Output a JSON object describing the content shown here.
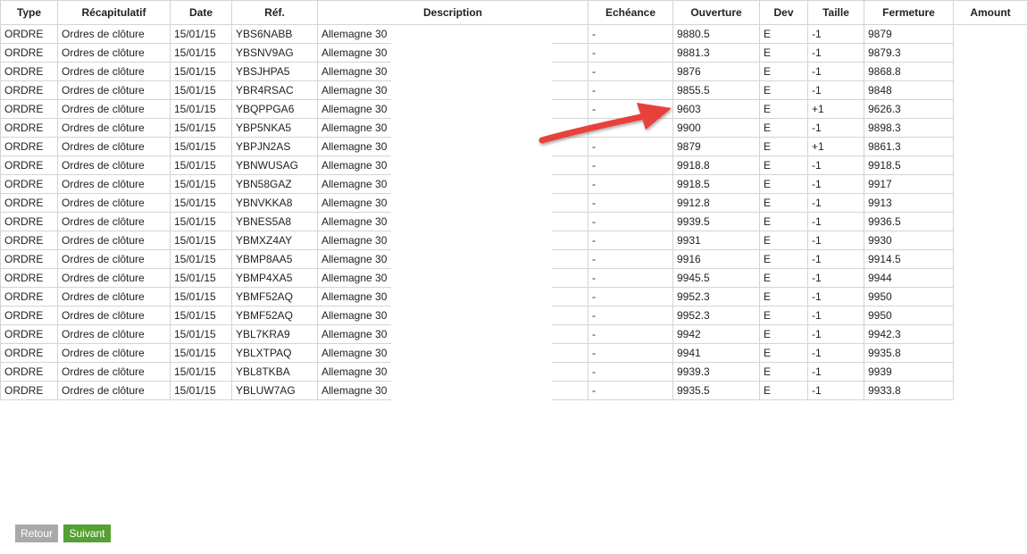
{
  "table": {
    "headers": [
      "Type",
      "Récapitulatif",
      "Date",
      "Réf.",
      "Description",
      "Echéance",
      "Ouverture",
      "Dev",
      "Taille",
      "Fermeture",
      "Amount"
    ],
    "rows": [
      [
        "ORDRE",
        "Ordres de clôture",
        "15/01/15",
        "YBS6NABB",
        "Allemagne 30",
        "-",
        "9880.5",
        "E",
        "-1",
        "9879",
        ""
      ],
      [
        "ORDRE",
        "Ordres de clôture",
        "15/01/15",
        "YBSNV9AG",
        "Allemagne 30",
        "-",
        "9881.3",
        "E",
        "-1",
        "9879.3",
        ""
      ],
      [
        "ORDRE",
        "Ordres de clôture",
        "15/01/15",
        "YBSJHPA5",
        "Allemagne 30",
        "-",
        "9876",
        "E",
        "-1",
        "9868.8",
        ""
      ],
      [
        "ORDRE",
        "Ordres de clôture",
        "15/01/15",
        "YBR4RSAC",
        "Allemagne 30",
        "-",
        "9855.5",
        "E",
        "-1",
        "9848",
        ""
      ],
      [
        "ORDRE",
        "Ordres de clôture",
        "15/01/15",
        "YBQPPGA6",
        "Allemagne 30",
        "-",
        "9603",
        "E",
        "+1",
        "9626.3",
        ""
      ],
      [
        "ORDRE",
        "Ordres de clôture",
        "15/01/15",
        "YBP5NKA5",
        "Allemagne 30",
        "-",
        "9900",
        "E",
        "-1",
        "9898.3",
        ""
      ],
      [
        "ORDRE",
        "Ordres de clôture",
        "15/01/15",
        "YBPJN2AS",
        "Allemagne 30",
        "-",
        "9879",
        "E",
        "+1",
        "9861.3",
        ""
      ],
      [
        "ORDRE",
        "Ordres de clôture",
        "15/01/15",
        "YBNWUSAG",
        "Allemagne 30",
        "-",
        "9918.8",
        "E",
        "-1",
        "9918.5",
        ""
      ],
      [
        "ORDRE",
        "Ordres de clôture",
        "15/01/15",
        "YBN58GAZ",
        "Allemagne 30",
        "-",
        "9918.5",
        "E",
        "-1",
        "9917",
        ""
      ],
      [
        "ORDRE",
        "Ordres de clôture",
        "15/01/15",
        "YBNVKKA8",
        "Allemagne 30",
        "-",
        "9912.8",
        "E",
        "-1",
        "9913",
        ""
      ],
      [
        "ORDRE",
        "Ordres de clôture",
        "15/01/15",
        "YBNES5A8",
        "Allemagne 30",
        "-",
        "9939.5",
        "E",
        "-1",
        "9936.5",
        ""
      ],
      [
        "ORDRE",
        "Ordres de clôture",
        "15/01/15",
        "YBMXZ4AY",
        "Allemagne 30",
        "-",
        "9931",
        "E",
        "-1",
        "9930",
        ""
      ],
      [
        "ORDRE",
        "Ordres de clôture",
        "15/01/15",
        "YBMP8AA5",
        "Allemagne 30",
        "-",
        "9916",
        "E",
        "-1",
        "9914.5",
        ""
      ],
      [
        "ORDRE",
        "Ordres de clôture",
        "15/01/15",
        "YBMP4XA5",
        "Allemagne 30",
        "-",
        "9945.5",
        "E",
        "-1",
        "9944",
        ""
      ],
      [
        "ORDRE",
        "Ordres de clôture",
        "15/01/15",
        "YBMF52AQ",
        "Allemagne 30",
        "-",
        "9952.3",
        "E",
        "-1",
        "9950",
        ""
      ],
      [
        "ORDRE",
        "Ordres de clôture",
        "15/01/15",
        "YBMF52AQ",
        "Allemagne 30",
        "-",
        "9952.3",
        "E",
        "-1",
        "9950",
        ""
      ],
      [
        "ORDRE",
        "Ordres de clôture",
        "15/01/15",
        "YBL7KRA9",
        "Allemagne 30",
        "-",
        "9942",
        "E",
        "-1",
        "9942.3",
        ""
      ],
      [
        "ORDRE",
        "Ordres de clôture",
        "15/01/15",
        "YBLXTPAQ",
        "Allemagne 30",
        "-",
        "9941",
        "E",
        "-1",
        "9935.8",
        ""
      ],
      [
        "ORDRE",
        "Ordres de clôture",
        "15/01/15",
        "YBL8TKBA",
        "Allemagne 30",
        "-",
        "9939.3",
        "E",
        "-1",
        "9939",
        ""
      ],
      [
        "ORDRE",
        "Ordres de clôture",
        "15/01/15",
        "YBLUW7AG",
        "Allemagne 30",
        "-",
        "9935.5",
        "E",
        "-1",
        "9933.8",
        ""
      ]
    ]
  },
  "navigation": {
    "back_label": "Retour",
    "next_label": "Suivant"
  },
  "colors": {
    "annotation_arrow": "#e8413a",
    "back_button": "#a9a9a9",
    "next_button": "#55a032",
    "grid_line": "#d4d4d4"
  }
}
